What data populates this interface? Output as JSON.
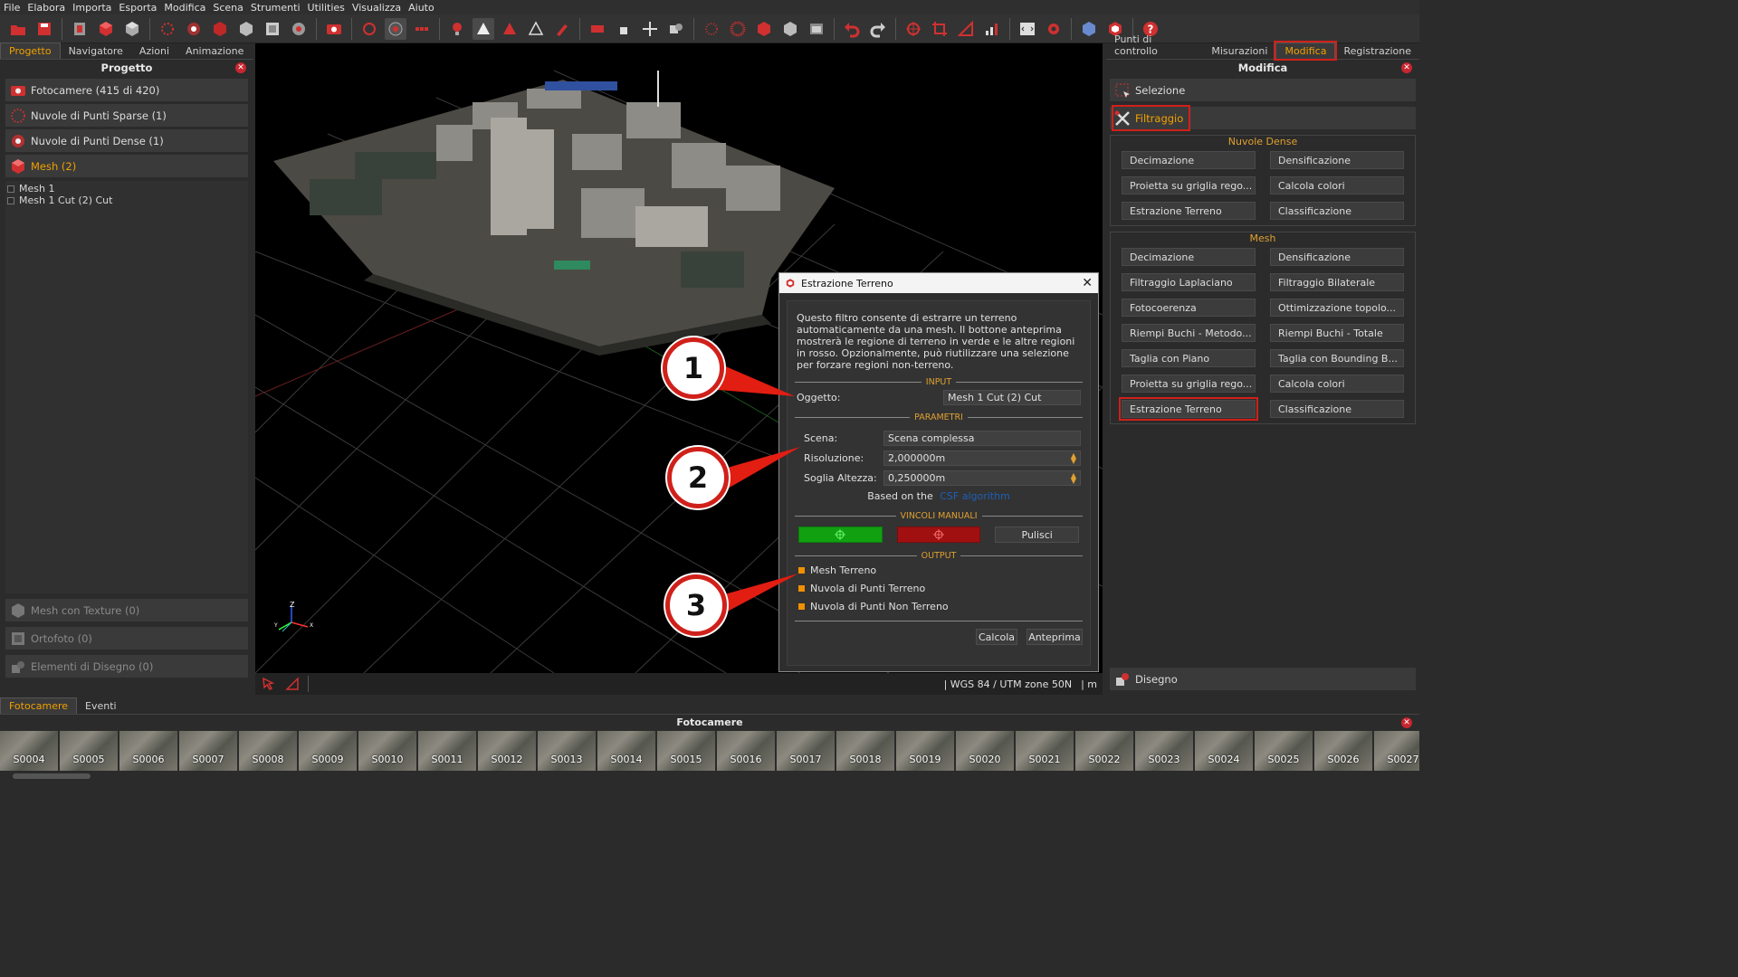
{
  "menu": [
    "File",
    "Elabora",
    "Importa",
    "Esporta",
    "Modifica",
    "Scena",
    "Strumenti",
    "Utilities",
    "Visualizza",
    "Aiuto"
  ],
  "left": {
    "tabs": [
      "Progetto",
      "Navigatore",
      "Azioni",
      "Animazione"
    ],
    "title": "Progetto",
    "items": [
      "Fotocamere (415 di 420)",
      "Nuvole di Punti Sparse (1)",
      "Nuvole di Punti Dense (1)",
      "Mesh (2)"
    ],
    "tree": [
      "Mesh 1",
      "Mesh 1 Cut (2) Cut"
    ],
    "bottom_items": [
      "Mesh con Texture (0)",
      "Ortofoto (0)",
      "Elementi di Disegno (0)"
    ]
  },
  "viewport": {
    "status": "| WGS 84 / UTM zone 50N",
    "unit": "| m",
    "axis_z": "Z",
    "axis_y": "Y",
    "axis_x": "X"
  },
  "right": {
    "tabs": [
      "Punti di controllo",
      "Misurazioni",
      "Modifica",
      "Registrazione"
    ],
    "title": "Modifica",
    "selection": "Selezione",
    "filtering": "Filtraggio",
    "dense_title": "Nuvole Dense",
    "dense_buttons": [
      "Decimazione",
      "Densificazione",
      "Proietta su griglia rego...",
      "Calcola colori",
      "Estrazione Terreno",
      "Classificazione"
    ],
    "mesh_title": "Mesh",
    "mesh_buttons": [
      "Decimazione",
      "Densificazione",
      "Filtraggio Laplaciano",
      "Filtraggio Bilaterale",
      "Fotocoerenza",
      "Ottimizzazione topolo...",
      "Riempi Buchi - Metodo...",
      "Riempi Buchi - Totale",
      "Taglia con Piano",
      "Taglia con Bounding B...",
      "Proietta su griglia rego...",
      "Calcola colori",
      "Estrazione Terreno",
      "Classificazione"
    ],
    "drawing": "Disegno"
  },
  "dialog": {
    "title": "Estrazione Terreno",
    "description": "Questo filtro consente di estrarre un terreno automaticamente da una mesh. Il bottone anteprima mostrerà le regione di terreno in verde e le altre regioni in rosso. Opzionalmente, può riutilizzare una selezione per forzare regioni non-terreno.",
    "input_label": "INPUT",
    "object_key": "Oggetto:",
    "object_value": "Mesh 1 Cut (2) Cut",
    "params_label": "PARAMETRI",
    "scene_key": "Scena:",
    "scene_value": "Scena complessa",
    "res_key": "Risoluzione:",
    "res_value": "2,000000m",
    "height_key": "Soglia Altezza:",
    "height_value": "0,250000m",
    "based_on": "Based on the",
    "based_link": "CSF algorithm",
    "manual_label": "VINCOLI MANUALI",
    "clear": "Pulisci",
    "output_label": "OUTPUT",
    "outputs": [
      "Mesh Terreno",
      "Nuvola di Punti Terreno",
      "Nuvola di Punti Non Terreno"
    ],
    "compute": "Calcola",
    "preview": "Anteprima"
  },
  "callouts": [
    "1",
    "2",
    "3"
  ],
  "bottom": {
    "tabs": [
      "Fotocamere",
      "Eventi"
    ],
    "title": "Fotocamere",
    "thumbs": [
      "S0004",
      "S0005",
      "S0006",
      "S0007",
      "S0008",
      "S0009",
      "S0010",
      "S0011",
      "S0012",
      "S0013",
      "S0014",
      "S0015",
      "S0016",
      "S0017",
      "S0018",
      "S0019",
      "S0020",
      "S0021",
      "S0022",
      "S0023",
      "S0024",
      "S0025",
      "S0026",
      "S0027"
    ]
  },
  "colors": {
    "accent": "#f0a000",
    "highlight": "#d0201a",
    "bg": "#2b2b2b"
  }
}
